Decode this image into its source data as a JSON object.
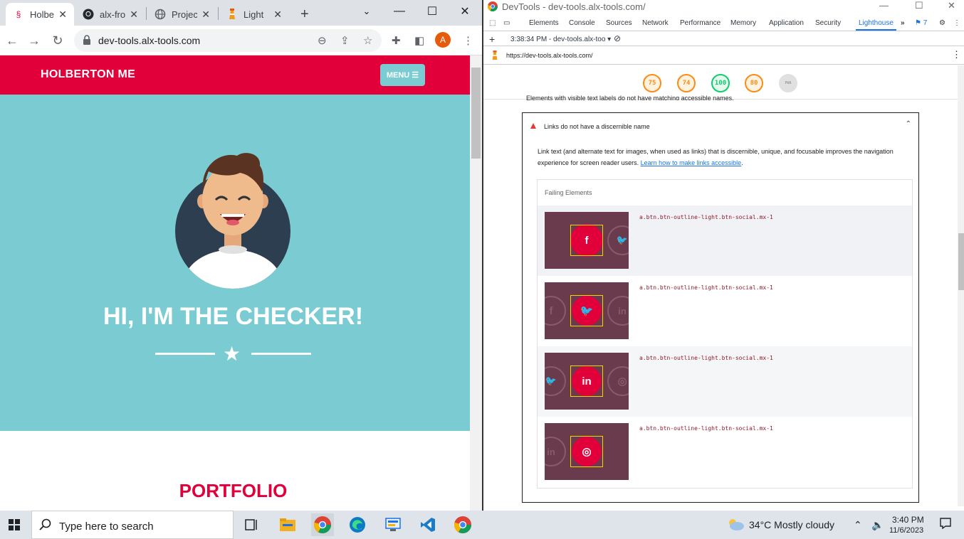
{
  "chrome": {
    "tabs": [
      {
        "label": "Holbe",
        "icon": "holberton-icon",
        "active": true
      },
      {
        "label": "alx-fro",
        "icon": "github-icon",
        "active": false
      },
      {
        "label": "Projec",
        "icon": "globe-icon",
        "active": false
      },
      {
        "label": "Light",
        "icon": "lighthouse-icon",
        "active": false
      }
    ],
    "new_tab_label": "+",
    "url": "dev-tools.alx-tools.com",
    "profile_initial": "A"
  },
  "site": {
    "brand": "HOLBERTON ME",
    "menu_label": "MENU",
    "hero_title": "HI, I'M THE CHECKER!",
    "section_title": "PORTFOLIO"
  },
  "devtools": {
    "window_title": "DevTools - dev-tools.alx-tools.com/",
    "tabs": [
      "Elements",
      "Console",
      "Sources",
      "Network",
      "Performance",
      "Memory",
      "Application",
      "Security",
      "Lighthouse"
    ],
    "active_tab": "Lighthouse",
    "issues_count": "7",
    "report_label": "3:38:34 PM - dev-tools.alx-too",
    "report_url": "https://dev-tools.alx-tools.com/",
    "scores": [
      {
        "value": "75",
        "color": "#fa8c16"
      },
      {
        "value": "74",
        "color": "#fa8c16"
      },
      {
        "value": "100",
        "color": "#0cce6b"
      },
      {
        "value": "80",
        "color": "#fa8c16"
      },
      {
        "value": "PWA",
        "color": "#9e9e9e"
      }
    ],
    "prev_audit_title": "Elements with visible text labels do not have matching accessible names.",
    "audit": {
      "title": "Links do not have a discernible name",
      "description": "Link text (and alternate text for images, when used as links) that is discernible, unique, and focusable improves the navigation experience for screen reader users.",
      "link_text": "Learn how to make links accessible",
      "failing_header": "Failing Elements",
      "elements": [
        {
          "selector": "a.btn.btn-outline-light.btn-social.mx-1",
          "icon": "f"
        },
        {
          "selector": "a.btn.btn-outline-light.btn-social.mx-1",
          "icon": "twitter"
        },
        {
          "selector": "a.btn.btn-outline-light.btn-social.mx-1",
          "icon": "in"
        },
        {
          "selector": "a.btn.btn-outline-light.btn-social.mx-1",
          "icon": "dribbble"
        }
      ]
    }
  },
  "taskbar": {
    "search_placeholder": "Type here to search",
    "weather": "34°C  Mostly cloudy",
    "time": "3:40 PM",
    "date": "11/6/2023"
  }
}
